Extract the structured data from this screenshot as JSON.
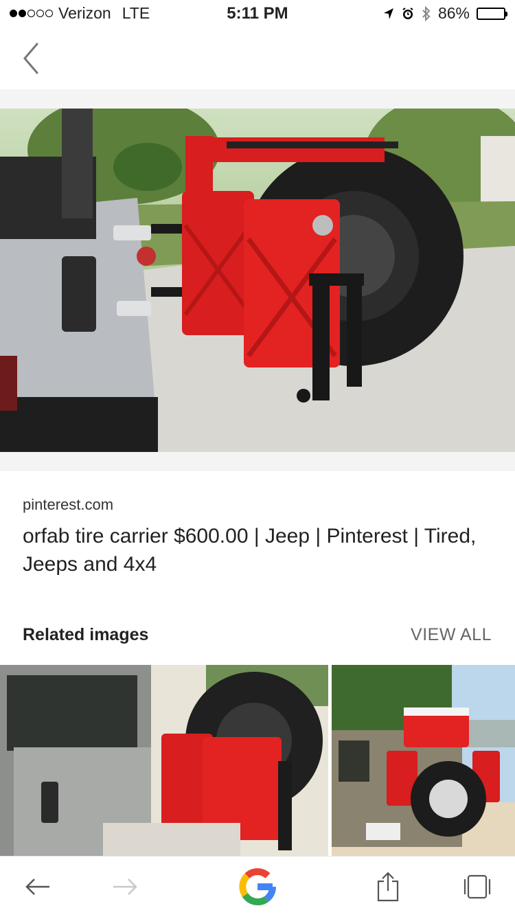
{
  "status": {
    "carrier": "Verizon",
    "network": "LTE",
    "time": "5:11 PM",
    "battery": "86%",
    "battery_level": 0.86,
    "icons": [
      "location-icon",
      "alarm-icon",
      "bluetooth-icon"
    ]
  },
  "result": {
    "source": "pinterest.com",
    "title": "orfab tire carrier $600.00 | Jeep | Pinterest | Tired, Jeeps and 4x4"
  },
  "related": {
    "heading": "Related images",
    "view_all": "VIEW ALL"
  },
  "toolbar": {
    "icons": [
      "back-arrow-icon",
      "forward-arrow-icon",
      "google-logo",
      "share-icon",
      "tabs-icon"
    ]
  },
  "colors": {
    "accent_red": "#d81e1e",
    "tire": "#1d1d1d",
    "jeep_silver": "#b9bcc0"
  }
}
